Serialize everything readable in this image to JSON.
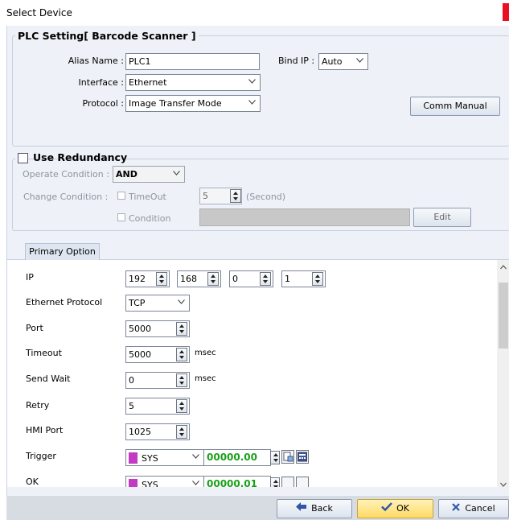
{
  "window": {
    "title": "Select Device"
  },
  "plc_setting": {
    "legend": "PLC Setting[ Barcode Scanner ]",
    "alias_label": "Alias Name :",
    "alias_value": "PLC1",
    "bind_ip_label": "Bind IP :",
    "bind_ip_value": "Auto",
    "interface_label": "Interface :",
    "interface_value": "Ethernet",
    "protocol_label": "Protocol :",
    "protocol_value": "Image Transfer Mode",
    "comm_manual_label": "Comm Manual"
  },
  "redundancy": {
    "legend": "Use Redundancy",
    "checked": false,
    "operate_label": "Operate Condition :",
    "operate_value": "AND",
    "change_label": "Change Condition :",
    "timeout_label": "TimeOut",
    "timeout_value": "5",
    "timeout_unit": "(Second)",
    "condition_label": "Condition",
    "edit_label": "Edit"
  },
  "tabs": [
    "Primary Option"
  ],
  "primary": {
    "ip_label": "IP",
    "ip": [
      "192",
      "168",
      "0",
      "1"
    ],
    "eth_protocol_label": "Ethernet Protocol",
    "eth_protocol_value": "TCP",
    "port_label": "Port",
    "port_value": "5000",
    "timeout_label": "Timeout",
    "timeout_value": "5000",
    "timeout_unit": "msec",
    "sendwait_label": "Send Wait",
    "sendwait_value": "0",
    "sendwait_unit": "msec",
    "retry_label": "Retry",
    "retry_value": "5",
    "hmiport_label": "HMI Port",
    "hmiport_value": "1025",
    "trigger_label": "Trigger",
    "trigger_device": "SYS",
    "trigger_addr": "00000.00",
    "ok_label": "OK",
    "ok_device": "SYS",
    "ok_addr": "00000.01"
  },
  "footer": {
    "back_label": "Back",
    "ok_label": "OK",
    "cancel_label": "Cancel"
  },
  "colors": {
    "accent_ok": "#ffe58a",
    "address_green": "#19a019",
    "device_swatch": "#c23bc2"
  }
}
